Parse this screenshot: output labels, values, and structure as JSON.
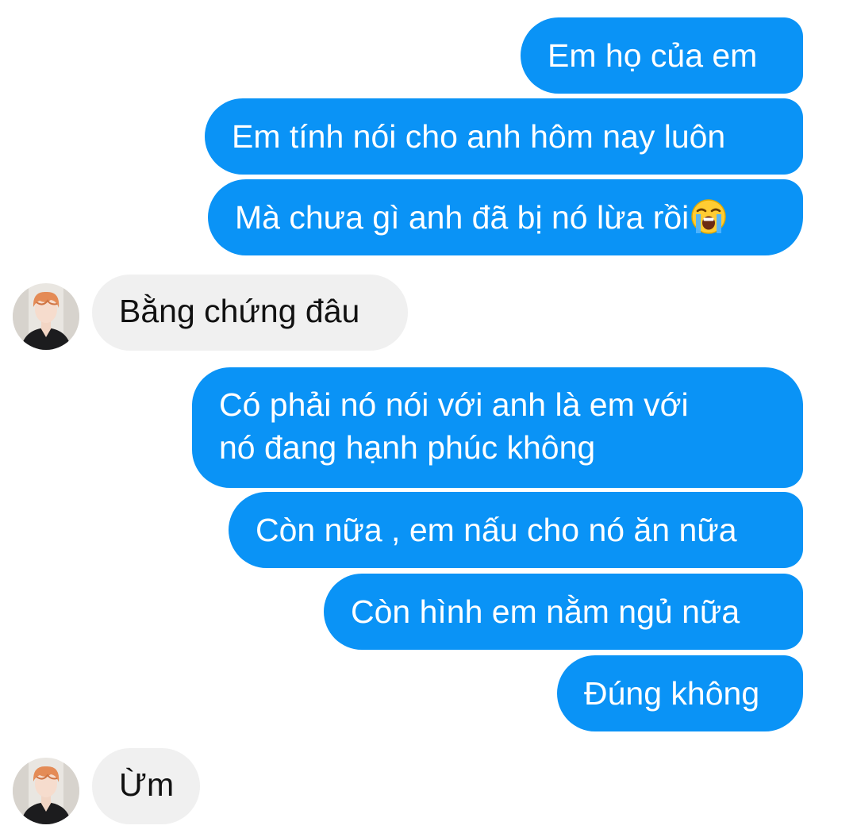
{
  "conversation": {
    "messages": [
      {
        "sender": "me",
        "text": "Em họ của em"
      },
      {
        "sender": "me",
        "text": "Em tính nói cho anh hôm nay luôn"
      },
      {
        "sender": "me",
        "text": "Mà chưa gì anh đã bị nó lừa rồi",
        "emoji": "loudly-crying-face-emoji"
      },
      {
        "sender": "contact",
        "text": "Bằng chứng đâu"
      },
      {
        "sender": "me",
        "lines": [
          "Có phải nó nói với anh là em với",
          "nó đang hạnh phúc không"
        ]
      },
      {
        "sender": "me",
        "text": "Còn nữa , em nấu cho nó ăn nữa"
      },
      {
        "sender": "me",
        "text": "Còn hình em nằm ngủ nữa"
      },
      {
        "sender": "me",
        "text": "Đúng không"
      },
      {
        "sender": "contact",
        "text": "Ừm"
      }
    ]
  },
  "colors": {
    "outgoing_bubble": "#0a93f6",
    "outgoing_text": "#ffffff",
    "incoming_bubble": "#f0f0f0",
    "incoming_text": "#111111",
    "background": "#ffffff"
  },
  "icons": {
    "contact_avatar": "contact-avatar-photo"
  }
}
